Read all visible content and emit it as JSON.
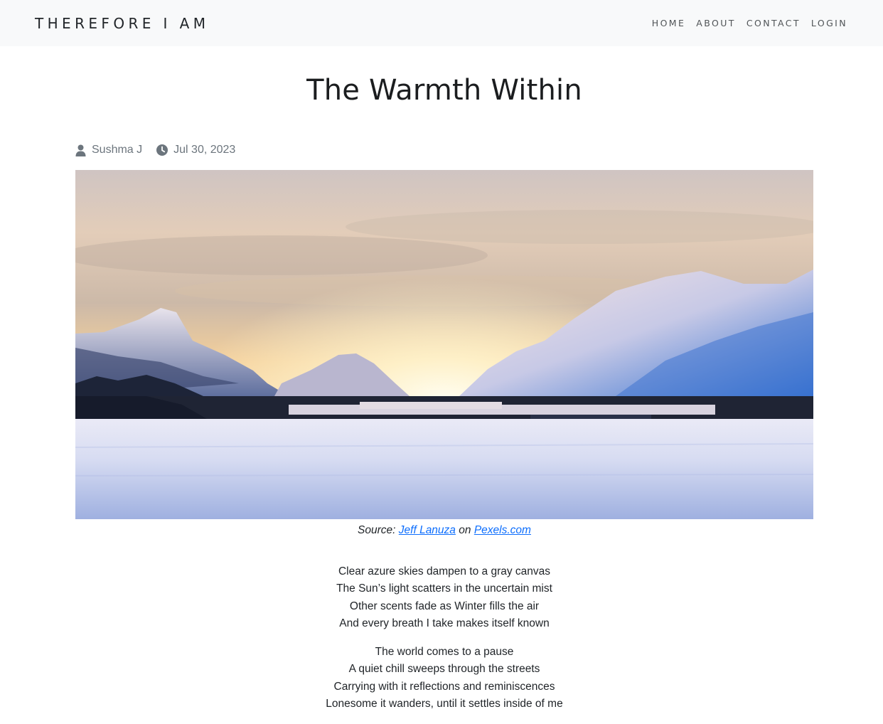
{
  "nav": {
    "brand": "THEREFORE I AM",
    "links": [
      "HOME",
      "ABOUT",
      "CONTACT",
      "LOGIN"
    ]
  },
  "post": {
    "title": "The Warmth Within",
    "author": "Sushma J",
    "date": "Jul 30, 2023",
    "image_icons": {
      "author": "user-icon",
      "date": "clock-icon"
    }
  },
  "caption": {
    "prefix": "Source:",
    "photographer": "Jeff Lanuza",
    "connector": "on",
    "site": "Pexels.com"
  },
  "poem": {
    "stanzas": [
      [
        "Clear azure skies dampen to a gray canvas",
        "The Sun’s light scatters in the uncertain mist",
        "Other scents fade as Winter fills the air",
        "And every breath I take makes itself known"
      ],
      [
        "The world comes to a pause",
        "A quiet chill sweeps through the streets",
        "Carrying with it reflections and reminiscences",
        "Lonesome it wanders, until it settles inside of me"
      ]
    ]
  },
  "colors": {
    "navbar_bg": "#f8f9fa",
    "link": "#0d6efd",
    "meta": "#6c757d"
  }
}
